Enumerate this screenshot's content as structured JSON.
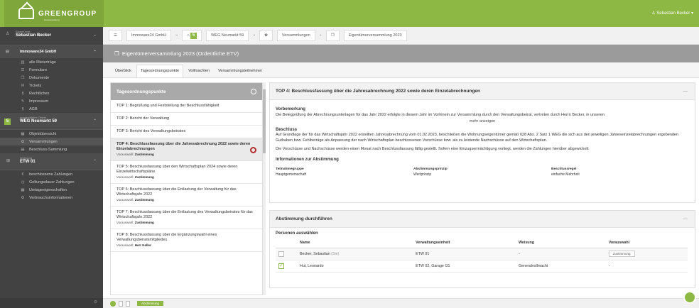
{
  "brand": {
    "name": "GREENGROUP",
    "tagline": "Hausverwaltung"
  },
  "topbar": {
    "user": "Sebastian Becker"
  },
  "sidebar": {
    "owner_label": "Eigentümer",
    "owner_name": "Sebastian Becker",
    "company": "Immoware24 GmbH",
    "company_items": [
      {
        "icon": "▥",
        "label": "alle Mieterträge"
      },
      {
        "icon": "☰",
        "label": "Formulare"
      },
      {
        "icon": "❐",
        "label": "Dokumente"
      },
      {
        "icon": "✉",
        "label": "Tickets"
      },
      {
        "icon": "§",
        "label": "Rechtliches"
      },
      {
        "icon": "✎",
        "label": "Impressum"
      },
      {
        "icon": "§",
        "label": "AGB"
      }
    ],
    "object_label": "ausgewähltes Objekt",
    "object_name": "WEG Neumarkt 59",
    "object_items": [
      {
        "icon": "▦",
        "label": "Objektübersicht"
      },
      {
        "icon": "✿",
        "label": "Versammlungen",
        "active": true
      },
      {
        "icon": "▤",
        "label": "Beschluss-Sammlung"
      }
    ],
    "unit_label": "Wohnung",
    "unit_name": "ETW 01",
    "unit_items": [
      {
        "icon": "€",
        "label": "beschlossene Zahlungen"
      },
      {
        "icon": "◷",
        "label": "Geltungsdauer Zahlungen"
      },
      {
        "icon": "▦",
        "label": "Umlageeigenschaften"
      },
      {
        "icon": "⚙",
        "label": "Verbrauchsinformationen"
      }
    ]
  },
  "breadcrumb": [
    "Immoware24 GmbH",
    "WEG Neumarkt 59",
    "Versammlungen",
    "Eigentümerversammlung 2023"
  ],
  "page_title": "Eigentümerversammlung 2023 (Ordentliche ETV)",
  "tabs": [
    "Überblick",
    "Tagesordnungspunkte",
    "Vollmachten",
    "Versammlungsteilnehmer"
  ],
  "agenda": {
    "header": "Tagesordnungspunkte",
    "items": [
      {
        "title": "TOP 1: Begrüßung und Feststellung der Beschlussfähigkeit",
        "vorauswahl": ""
      },
      {
        "title": "TOP 2: Bericht der Verwaltung",
        "vorauswahl": ""
      },
      {
        "title": "TOP 3: Bericht des Verwaltungsbeirates",
        "vorauswahl": ""
      },
      {
        "title": "TOP 4: Beschlussfassung über die Jahresabrechnung 2022 sowie deren Einzelabrechnungen",
        "vorauswahl": "Zustimmung",
        "active": true
      },
      {
        "title": "TOP 5: Beschlussfassung über den Wirtschaftsplan 2024 sowie deren Einzelwirtschaftspläne",
        "vorauswahl": "Zustimmung"
      },
      {
        "title": "TOP 6: Beschlussfassung über die Entlastung der Verwaltung für das Wirtschaftsjahr 2022",
        "vorauswahl": "Zustimmung"
      },
      {
        "title": "TOP 7: Beschlussfassung über die Entlastung des Verwaltungsbeirates für das Wirtschaftsjahr 2022",
        "vorauswahl": "Zustimmung"
      },
      {
        "title": "TOP 8: Beschlussfassung über die Ergänzungswahl eines Verwaltungsbeiratsmitgliedes",
        "vorauswahl": "Herr Keller"
      }
    ],
    "vorauswahl_label": "Vorauswahl:"
  },
  "detail": {
    "header": "TOP 4: Beschlussfassung über die Jahresabrechnung 2022 sowie deren Einzelabrechnungen",
    "vorbemerkung_label": "Vorbemerkung",
    "vorbemerkung_text": "Die Belegprüfung der Abrechnungsunterlagen für das Jahr 2022 erfolgte in diesem Jahr im Vorhinein zur Versammlung durch den Verwaltungsbeirat, vertreten durch Herrn Becker, in unseren",
    "more": "mehr anzeigen",
    "beschluss_label": "Beschluss",
    "beschluss_text": "Auf Grundlage der für das Wirtschaftsjahr 2022 erstellten Jahresabrechnung vom 01.02.2023, beschließen die Wohnungseigentümer gemäß §28 Abs. 2 Satz 1 WEG die sich aus den jeweiligen Jahreseinzelabrechnungen ergebenden Guthaben bzw. Fehlbeträge als Anpassung der nach Wirtschaftsplan beschlossenen Vorschüsse bzw. als zu leistende Nachschüsse auf den Wirtschaftsplan.",
    "beschluss_text2": "Die Vorschüsse und Nachschüsse werden einen Monat nach Beschlussfassung fällig gestellt. Sofern eine Einzugsermächtigung vorliegt, werden die Zahlungen hierüber abgewickelt.",
    "info_label": "Informationen zur Abstimmung",
    "info_cols": [
      {
        "label": "Teilnahmegruppe",
        "value": "Hauptgemeinschaft"
      },
      {
        "label": "Abstimmungsprinzip",
        "value": "Wertprinzip"
      },
      {
        "label": "Beschlussregel",
        "value": "einfache Mehrheit"
      }
    ]
  },
  "vote": {
    "header": "Abstimmung durchführen",
    "persons_label": "Personen auswählen",
    "columns": [
      "Name",
      "Verwaltungseinheit",
      "Weisung",
      "Vorauswahl"
    ],
    "rows": [
      {
        "checked": false,
        "name": "Becker, Sebastian",
        "note": "(Sie)",
        "unit": "ETW 01",
        "weisung": "-",
        "vorauswahl": "Zustimmung"
      },
      {
        "checked": true,
        "name": "Hut, Leonardo",
        "note": "",
        "unit": "ETW 02, Garage G1",
        "weisung": "Generalvollmacht",
        "vorauswahl": "-"
      }
    ]
  },
  "bottom": {
    "page": "1",
    "action": "Abstimmung"
  }
}
